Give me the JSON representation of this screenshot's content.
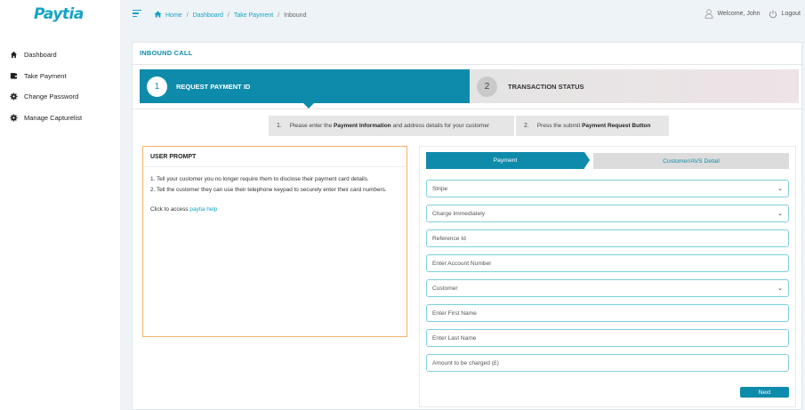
{
  "app": {
    "logo": "Paytia"
  },
  "sidebar": {
    "items": [
      {
        "label": "Dashboard",
        "icon": "home-icon"
      },
      {
        "label": "Take Payment",
        "icon": "wallet-icon"
      },
      {
        "label": "Change Password",
        "icon": "gear-icon"
      },
      {
        "label": "Manage Capturelist",
        "icon": "gear-icon"
      }
    ]
  },
  "breadcrumb": {
    "items": [
      "Home",
      "Dashboard",
      "Take Payment"
    ],
    "current": "Inbound"
  },
  "user": {
    "welcome": "Welcome, John",
    "logout": "Logout"
  },
  "card": {
    "title": "INBOUND CALL"
  },
  "steps": [
    {
      "number": "1",
      "label": "REQUEST PAYMENT ID",
      "active": true
    },
    {
      "number": "2",
      "label": "TRANSACTION STATUS",
      "active": false
    }
  ],
  "instructions": [
    {
      "number": "1.",
      "prefix": "Please enter the ",
      "bold": "Payment Information",
      "suffix": " and address details for your customer"
    },
    {
      "number": "2.",
      "prefix": "Press the submit ",
      "bold": "Payment Request Button",
      "suffix": ""
    }
  ],
  "prompt": {
    "title": "USER PROMPT",
    "line1": "1. Tell your customer you no longer require them to disclose their payment card details.",
    "line2": "2. Tell the customer they can use their telephone keypad to securely enter their card numbers.",
    "help_prefix": "Click to access ",
    "help_link": "paytia help"
  },
  "form": {
    "tabs": {
      "payment": "Payment",
      "customer": "Customer/AVS Detail"
    },
    "gateway_select": "Stripe",
    "charge_select": "Charge Immediately",
    "reference_placeholder": "Reference Id",
    "account_placeholder": "Enter Account Number",
    "type_select": "Customer",
    "first_name_placeholder": "Enter First Name",
    "last_name_placeholder": "Enter Last Name",
    "amount_placeholder": "Amount to be charged (£)",
    "next_label": "Next"
  },
  "colors": {
    "brand": "#0e8bab",
    "accent": "#13a3c4",
    "prompt_border": "#f3b36d"
  }
}
